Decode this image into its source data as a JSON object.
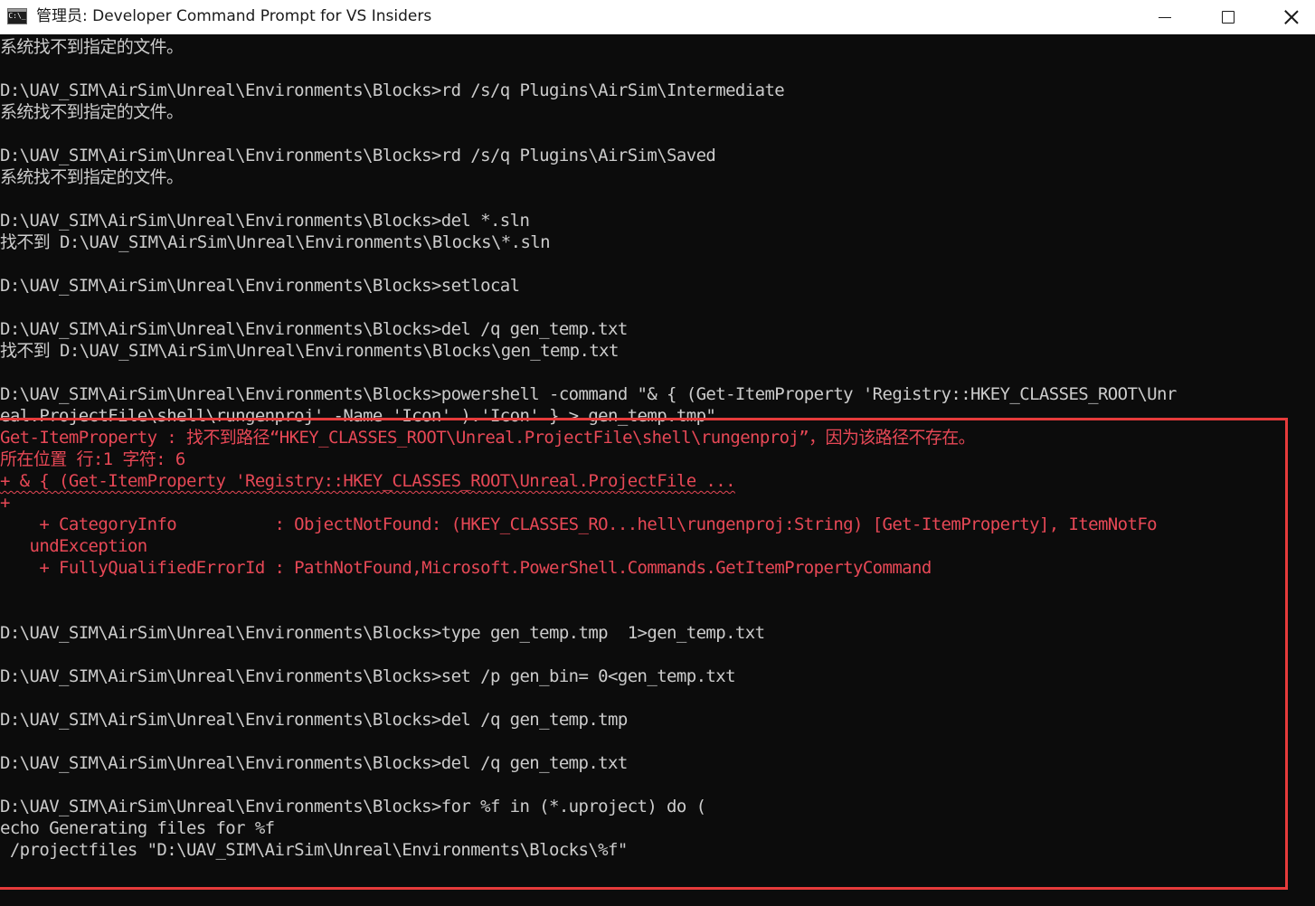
{
  "window": {
    "title": "管理员: Developer Command Prompt for VS Insiders",
    "icon_label": "C:\\_",
    "controls": [
      "minimize-icon",
      "maximize-icon",
      "close-icon"
    ]
  },
  "colors": {
    "console_bg": "#0c0c0c",
    "console_text": "#cccccc",
    "error_text": "#e74856",
    "highlight_border": "#e63b3b",
    "titlebar_bg": "#ffffff"
  },
  "console": {
    "lines": [
      {
        "text": "系统找不到指定的文件。",
        "kind": "normal"
      },
      {
        "text": "",
        "kind": "normal"
      },
      {
        "text": "D:\\UAV_SIM\\AirSim\\Unreal\\Environments\\Blocks>rd /s/q Plugins\\AirSim\\Intermediate",
        "kind": "normal"
      },
      {
        "text": "系统找不到指定的文件。",
        "kind": "normal"
      },
      {
        "text": "",
        "kind": "normal"
      },
      {
        "text": "D:\\UAV_SIM\\AirSim\\Unreal\\Environments\\Blocks>rd /s/q Plugins\\AirSim\\Saved",
        "kind": "normal"
      },
      {
        "text": "系统找不到指定的文件。",
        "kind": "normal"
      },
      {
        "text": "",
        "kind": "normal"
      },
      {
        "text": "D:\\UAV_SIM\\AirSim\\Unreal\\Environments\\Blocks>del *.sln",
        "kind": "normal"
      },
      {
        "text": "找不到 D:\\UAV_SIM\\AirSim\\Unreal\\Environments\\Blocks\\*.sln",
        "kind": "normal"
      },
      {
        "text": "",
        "kind": "normal"
      },
      {
        "text": "D:\\UAV_SIM\\AirSim\\Unreal\\Environments\\Blocks>setlocal",
        "kind": "normal"
      },
      {
        "text": "",
        "kind": "normal"
      },
      {
        "text": "D:\\UAV_SIM\\AirSim\\Unreal\\Environments\\Blocks>del /q gen_temp.txt",
        "kind": "normal"
      },
      {
        "text": "找不到 D:\\UAV_SIM\\AirSim\\Unreal\\Environments\\Blocks\\gen_temp.txt",
        "kind": "normal"
      },
      {
        "text": "",
        "kind": "normal"
      },
      {
        "text": "D:\\UAV_SIM\\AirSim\\Unreal\\Environments\\Blocks>powershell -command \"& { (Get-ItemProperty 'Registry::HKEY_CLASSES_ROOT\\Unr",
        "kind": "normal"
      },
      {
        "text": "eal.ProjectFile\\shell\\rungenproj' -Name 'Icon' ).'Icon' } > gen_temp.tmp\"",
        "kind": "normal"
      },
      {
        "text": "Get-ItemProperty : 找不到路径“HKEY_CLASSES_ROOT\\Unreal.ProjectFile\\shell\\rungenproj”，因为该路径不存在。",
        "kind": "red"
      },
      {
        "text": "所在位置 行:1 字符: 6",
        "kind": "red"
      },
      {
        "text": "+ & { (Get-ItemProperty 'Registry::HKEY_CLASSES_ROOT\\Unreal.ProjectFile ...",
        "kind": "red-squiggle"
      },
      {
        "text": "+",
        "kind": "red"
      },
      {
        "text": "    + CategoryInfo          : ObjectNotFound: (HKEY_CLASSES_RO...hell\\rungenproj:String) [Get-ItemProperty], ItemNotFo",
        "kind": "red"
      },
      {
        "text": "   undException",
        "kind": "red"
      },
      {
        "text": "    + FullyQualifiedErrorId : PathNotFound,Microsoft.PowerShell.Commands.GetItemPropertyCommand",
        "kind": "red"
      },
      {
        "text": "",
        "kind": "normal"
      },
      {
        "text": "",
        "kind": "normal"
      },
      {
        "text": "D:\\UAV_SIM\\AirSim\\Unreal\\Environments\\Blocks>type gen_temp.tmp  1>gen_temp.txt",
        "kind": "normal"
      },
      {
        "text": "",
        "kind": "normal"
      },
      {
        "text": "D:\\UAV_SIM\\AirSim\\Unreal\\Environments\\Blocks>set /p gen_bin= 0<gen_temp.txt",
        "kind": "normal"
      },
      {
        "text": "",
        "kind": "normal"
      },
      {
        "text": "D:\\UAV_SIM\\AirSim\\Unreal\\Environments\\Blocks>del /q gen_temp.tmp",
        "kind": "normal"
      },
      {
        "text": "",
        "kind": "normal"
      },
      {
        "text": "D:\\UAV_SIM\\AirSim\\Unreal\\Environments\\Blocks>del /q gen_temp.txt",
        "kind": "normal"
      },
      {
        "text": "",
        "kind": "normal"
      },
      {
        "text": "D:\\UAV_SIM\\AirSim\\Unreal\\Environments\\Blocks>for %f in (*.uproject) do (",
        "kind": "normal"
      },
      {
        "text": "echo Generating files for %f",
        "kind": "normal"
      },
      {
        "text": " /projectfiles \"D:\\UAV_SIM\\AirSim\\Unreal\\Environments\\Blocks\\%f\"",
        "kind": "normal"
      },
      {
        "text": "",
        "kind": "normal"
      }
    ]
  }
}
